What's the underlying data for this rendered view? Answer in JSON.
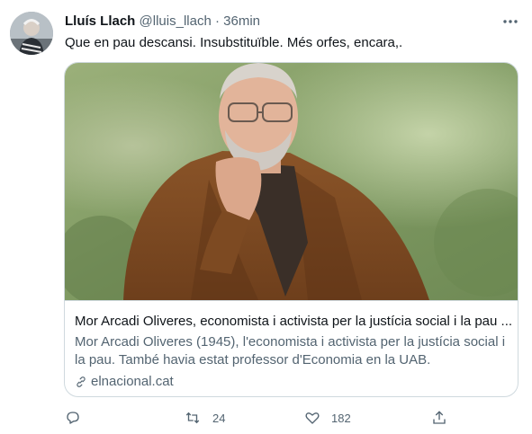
{
  "author": {
    "name": "Lluís Llach",
    "handle": "@lluis_llach",
    "separator": "·",
    "time": "36min"
  },
  "tweet_text": "Que en pau descansi. Insubstituïble. Més orfes, encara,.",
  "card": {
    "title": "Mor Arcadi Oliveres, economista i activista per la justícia social i la pau ...",
    "description": "Mor Arcadi Oliveres (1945), l'economista i activista per la justícia social i la pau. També havia estat professor d'Economia en la UAB.",
    "source": "elnacional.cat"
  },
  "actions": {
    "reply_count": "",
    "retweet_count": "24",
    "like_count": "182"
  },
  "icons": {
    "more": "more-icon",
    "reply": "reply-icon",
    "retweet": "retweet-icon",
    "like": "like-icon",
    "share": "share-icon",
    "link": "link-icon"
  },
  "colors": {
    "text": "#0f1419",
    "secondary": "#536471",
    "border": "#cfd9de"
  }
}
